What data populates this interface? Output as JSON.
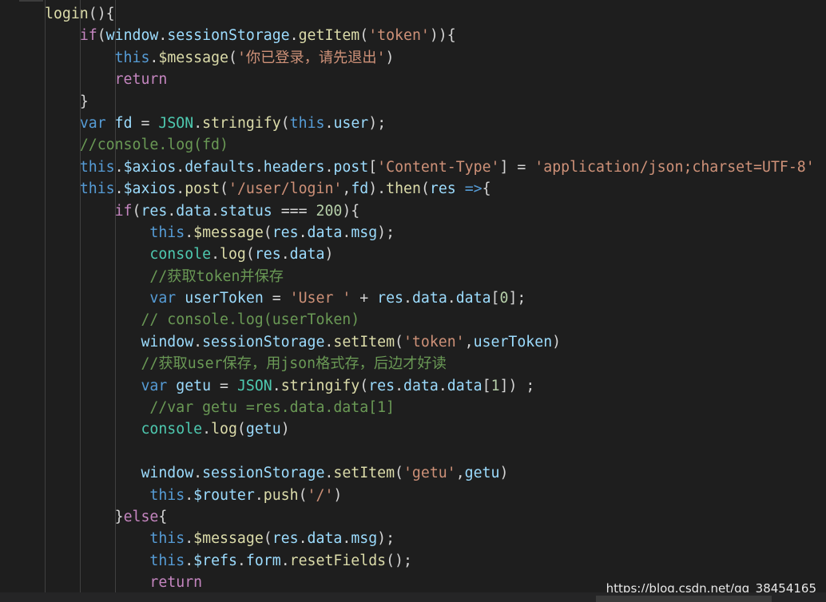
{
  "editor": {
    "colors": {
      "background": "#1e1e1e",
      "default": "#d4d4d4",
      "function": "#dcdcaa",
      "keyword": "#569cd6",
      "control": "#c586c0",
      "variable": "#9cdcfe",
      "string": "#ce9178",
      "number": "#b5cea8",
      "comment": "#6a9955",
      "class": "#4ec9b0"
    },
    "lines": [
      [
        {
          "t": "login",
          "c": "fn"
        },
        {
          "t": "(){",
          "c": "pun"
        }
      ],
      [
        {
          "t": "    ",
          "c": "ws"
        },
        {
          "t": "if",
          "c": "ctl"
        },
        {
          "t": "(",
          "c": "pun"
        },
        {
          "t": "window",
          "c": "var"
        },
        {
          "t": ".",
          "c": "pun"
        },
        {
          "t": "sessionStorage",
          "c": "var"
        },
        {
          "t": ".",
          "c": "pun"
        },
        {
          "t": "getItem",
          "c": "fn"
        },
        {
          "t": "(",
          "c": "pun"
        },
        {
          "t": "'token'",
          "c": "str"
        },
        {
          "t": ")){",
          "c": "pun"
        }
      ],
      [
        {
          "t": "        ",
          "c": "ws"
        },
        {
          "t": "this",
          "c": "kw"
        },
        {
          "t": ".",
          "c": "pun"
        },
        {
          "t": "$message",
          "c": "fn"
        },
        {
          "t": "(",
          "c": "pun"
        },
        {
          "t": "'你已登录，请先退出'",
          "c": "str"
        },
        {
          "t": ")",
          "c": "pun"
        }
      ],
      [
        {
          "t": "        ",
          "c": "ws"
        },
        {
          "t": "return",
          "c": "ctl"
        }
      ],
      [
        {
          "t": "    ",
          "c": "ws"
        },
        {
          "t": "}",
          "c": "pun"
        }
      ],
      [
        {
          "t": "    ",
          "c": "ws"
        },
        {
          "t": "var",
          "c": "kw"
        },
        {
          "t": " ",
          "c": "ws"
        },
        {
          "t": "fd",
          "c": "var"
        },
        {
          "t": " = ",
          "c": "pun"
        },
        {
          "t": "JSON",
          "c": "cls"
        },
        {
          "t": ".",
          "c": "pun"
        },
        {
          "t": "stringify",
          "c": "fn"
        },
        {
          "t": "(",
          "c": "pun"
        },
        {
          "t": "this",
          "c": "kw"
        },
        {
          "t": ".",
          "c": "pun"
        },
        {
          "t": "user",
          "c": "var"
        },
        {
          "t": ");",
          "c": "pun"
        }
      ],
      [
        {
          "t": "    ",
          "c": "ws"
        },
        {
          "t": "//console.log(fd)",
          "c": "cmt"
        }
      ],
      [
        {
          "t": "    ",
          "c": "ws"
        },
        {
          "t": "this",
          "c": "kw"
        },
        {
          "t": ".",
          "c": "pun"
        },
        {
          "t": "$axios",
          "c": "var"
        },
        {
          "t": ".",
          "c": "pun"
        },
        {
          "t": "defaults",
          "c": "var"
        },
        {
          "t": ".",
          "c": "pun"
        },
        {
          "t": "headers",
          "c": "var"
        },
        {
          "t": ".",
          "c": "pun"
        },
        {
          "t": "post",
          "c": "var"
        },
        {
          "t": "[",
          "c": "pun"
        },
        {
          "t": "'Content-Type'",
          "c": "str"
        },
        {
          "t": "] = ",
          "c": "pun"
        },
        {
          "t": "'application/json;charset=UTF-8'",
          "c": "str"
        }
      ],
      [
        {
          "t": "    ",
          "c": "ws"
        },
        {
          "t": "this",
          "c": "kw"
        },
        {
          "t": ".",
          "c": "pun"
        },
        {
          "t": "$axios",
          "c": "var"
        },
        {
          "t": ".",
          "c": "pun"
        },
        {
          "t": "post",
          "c": "fn"
        },
        {
          "t": "(",
          "c": "pun"
        },
        {
          "t": "'/user/login'",
          "c": "str"
        },
        {
          "t": ",",
          "c": "pun"
        },
        {
          "t": "fd",
          "c": "var"
        },
        {
          "t": ").",
          "c": "pun"
        },
        {
          "t": "then",
          "c": "fn"
        },
        {
          "t": "(",
          "c": "pun"
        },
        {
          "t": "res",
          "c": "var"
        },
        {
          "t": " ",
          "c": "ws"
        },
        {
          "t": "=>",
          "c": "kw"
        },
        {
          "t": "{",
          "c": "pun"
        }
      ],
      [
        {
          "t": "        ",
          "c": "ws"
        },
        {
          "t": "if",
          "c": "ctl"
        },
        {
          "t": "(",
          "c": "pun"
        },
        {
          "t": "res",
          "c": "var"
        },
        {
          "t": ".",
          "c": "pun"
        },
        {
          "t": "data",
          "c": "var"
        },
        {
          "t": ".",
          "c": "pun"
        },
        {
          "t": "status",
          "c": "var"
        },
        {
          "t": " === ",
          "c": "pun"
        },
        {
          "t": "200",
          "c": "num"
        },
        {
          "t": "){",
          "c": "pun"
        }
      ],
      [
        {
          "t": "            ",
          "c": "ws"
        },
        {
          "t": "this",
          "c": "kw"
        },
        {
          "t": ".",
          "c": "pun"
        },
        {
          "t": "$message",
          "c": "fn"
        },
        {
          "t": "(",
          "c": "pun"
        },
        {
          "t": "res",
          "c": "var"
        },
        {
          "t": ".",
          "c": "pun"
        },
        {
          "t": "data",
          "c": "var"
        },
        {
          "t": ".",
          "c": "pun"
        },
        {
          "t": "msg",
          "c": "var"
        },
        {
          "t": ");",
          "c": "pun"
        }
      ],
      [
        {
          "t": "            ",
          "c": "ws"
        },
        {
          "t": "console",
          "c": "cls"
        },
        {
          "t": ".",
          "c": "pun"
        },
        {
          "t": "log",
          "c": "fn"
        },
        {
          "t": "(",
          "c": "pun"
        },
        {
          "t": "res",
          "c": "var"
        },
        {
          "t": ".",
          "c": "pun"
        },
        {
          "t": "data",
          "c": "var"
        },
        {
          "t": ")",
          "c": "pun"
        }
      ],
      [
        {
          "t": "            ",
          "c": "ws"
        },
        {
          "t": "//获取token并保存",
          "c": "cmt"
        }
      ],
      [
        {
          "t": "            ",
          "c": "ws"
        },
        {
          "t": "var",
          "c": "kw"
        },
        {
          "t": " ",
          "c": "ws"
        },
        {
          "t": "userToken",
          "c": "var"
        },
        {
          "t": " = ",
          "c": "pun"
        },
        {
          "t": "'User '",
          "c": "str"
        },
        {
          "t": " + ",
          "c": "pun"
        },
        {
          "t": "res",
          "c": "var"
        },
        {
          "t": ".",
          "c": "pun"
        },
        {
          "t": "data",
          "c": "var"
        },
        {
          "t": ".",
          "c": "pun"
        },
        {
          "t": "data",
          "c": "var"
        },
        {
          "t": "[",
          "c": "pun"
        },
        {
          "t": "0",
          "c": "num"
        },
        {
          "t": "];",
          "c": "pun"
        }
      ],
      [
        {
          "t": "           ",
          "c": "ws"
        },
        {
          "t": "// console.log(userToken)",
          "c": "cmt"
        }
      ],
      [
        {
          "t": "           ",
          "c": "ws"
        },
        {
          "t": "window",
          "c": "var"
        },
        {
          "t": ".",
          "c": "pun"
        },
        {
          "t": "sessionStorage",
          "c": "var"
        },
        {
          "t": ".",
          "c": "pun"
        },
        {
          "t": "setItem",
          "c": "fn"
        },
        {
          "t": "(",
          "c": "pun"
        },
        {
          "t": "'token'",
          "c": "str"
        },
        {
          "t": ",",
          "c": "pun"
        },
        {
          "t": "userToken",
          "c": "var"
        },
        {
          "t": ")",
          "c": "pun"
        }
      ],
      [
        {
          "t": "           ",
          "c": "ws"
        },
        {
          "t": "//获取user保存，用json格式存，后边才好读",
          "c": "cmt"
        }
      ],
      [
        {
          "t": "           ",
          "c": "ws"
        },
        {
          "t": "var",
          "c": "kw"
        },
        {
          "t": " ",
          "c": "ws"
        },
        {
          "t": "getu",
          "c": "var"
        },
        {
          "t": " = ",
          "c": "pun"
        },
        {
          "t": "JSON",
          "c": "cls"
        },
        {
          "t": ".",
          "c": "pun"
        },
        {
          "t": "stringify",
          "c": "fn"
        },
        {
          "t": "(",
          "c": "pun"
        },
        {
          "t": "res",
          "c": "var"
        },
        {
          "t": ".",
          "c": "pun"
        },
        {
          "t": "data",
          "c": "var"
        },
        {
          "t": ".",
          "c": "pun"
        },
        {
          "t": "data",
          "c": "var"
        },
        {
          "t": "[",
          "c": "pun"
        },
        {
          "t": "1",
          "c": "num"
        },
        {
          "t": "]) ;",
          "c": "pun"
        }
      ],
      [
        {
          "t": "            ",
          "c": "ws"
        },
        {
          "t": "//var getu =res.data.data[1]",
          "c": "cmt"
        }
      ],
      [
        {
          "t": "           ",
          "c": "ws"
        },
        {
          "t": "console",
          "c": "cls"
        },
        {
          "t": ".",
          "c": "pun"
        },
        {
          "t": "log",
          "c": "fn"
        },
        {
          "t": "(",
          "c": "pun"
        },
        {
          "t": "getu",
          "c": "var"
        },
        {
          "t": ")",
          "c": "pun"
        }
      ],
      [
        {
          "t": "",
          "c": "ws"
        }
      ],
      [
        {
          "t": "           ",
          "c": "ws"
        },
        {
          "t": "window",
          "c": "var"
        },
        {
          "t": ".",
          "c": "pun"
        },
        {
          "t": "sessionStorage",
          "c": "var"
        },
        {
          "t": ".",
          "c": "pun"
        },
        {
          "t": "setItem",
          "c": "fn"
        },
        {
          "t": "(",
          "c": "pun"
        },
        {
          "t": "'getu'",
          "c": "str"
        },
        {
          "t": ",",
          "c": "pun"
        },
        {
          "t": "getu",
          "c": "var"
        },
        {
          "t": ")",
          "c": "pun"
        }
      ],
      [
        {
          "t": "            ",
          "c": "ws"
        },
        {
          "t": "this",
          "c": "kw"
        },
        {
          "t": ".",
          "c": "pun"
        },
        {
          "t": "$router",
          "c": "var"
        },
        {
          "t": ".",
          "c": "pun"
        },
        {
          "t": "push",
          "c": "fn"
        },
        {
          "t": "(",
          "c": "pun"
        },
        {
          "t": "'/'",
          "c": "str"
        },
        {
          "t": ")",
          "c": "pun"
        }
      ],
      [
        {
          "t": "        ",
          "c": "ws"
        },
        {
          "t": "}",
          "c": "pun"
        },
        {
          "t": "else",
          "c": "ctl"
        },
        {
          "t": "{",
          "c": "pun"
        }
      ],
      [
        {
          "t": "            ",
          "c": "ws"
        },
        {
          "t": "this",
          "c": "kw"
        },
        {
          "t": ".",
          "c": "pun"
        },
        {
          "t": "$message",
          "c": "fn"
        },
        {
          "t": "(",
          "c": "pun"
        },
        {
          "t": "res",
          "c": "var"
        },
        {
          "t": ".",
          "c": "pun"
        },
        {
          "t": "data",
          "c": "var"
        },
        {
          "t": ".",
          "c": "pun"
        },
        {
          "t": "msg",
          "c": "var"
        },
        {
          "t": ");",
          "c": "pun"
        }
      ],
      [
        {
          "t": "            ",
          "c": "ws"
        },
        {
          "t": "this",
          "c": "kw"
        },
        {
          "t": ".",
          "c": "pun"
        },
        {
          "t": "$refs",
          "c": "var"
        },
        {
          "t": ".",
          "c": "pun"
        },
        {
          "t": "form",
          "c": "var"
        },
        {
          "t": ".",
          "c": "pun"
        },
        {
          "t": "resetFields",
          "c": "fn"
        },
        {
          "t": "();",
          "c": "pun"
        }
      ],
      [
        {
          "t": "            ",
          "c": "ws"
        },
        {
          "t": "return",
          "c": "ctl"
        }
      ]
    ]
  },
  "watermark": {
    "text": "https://blog.csdn.net/qq_38454165"
  }
}
